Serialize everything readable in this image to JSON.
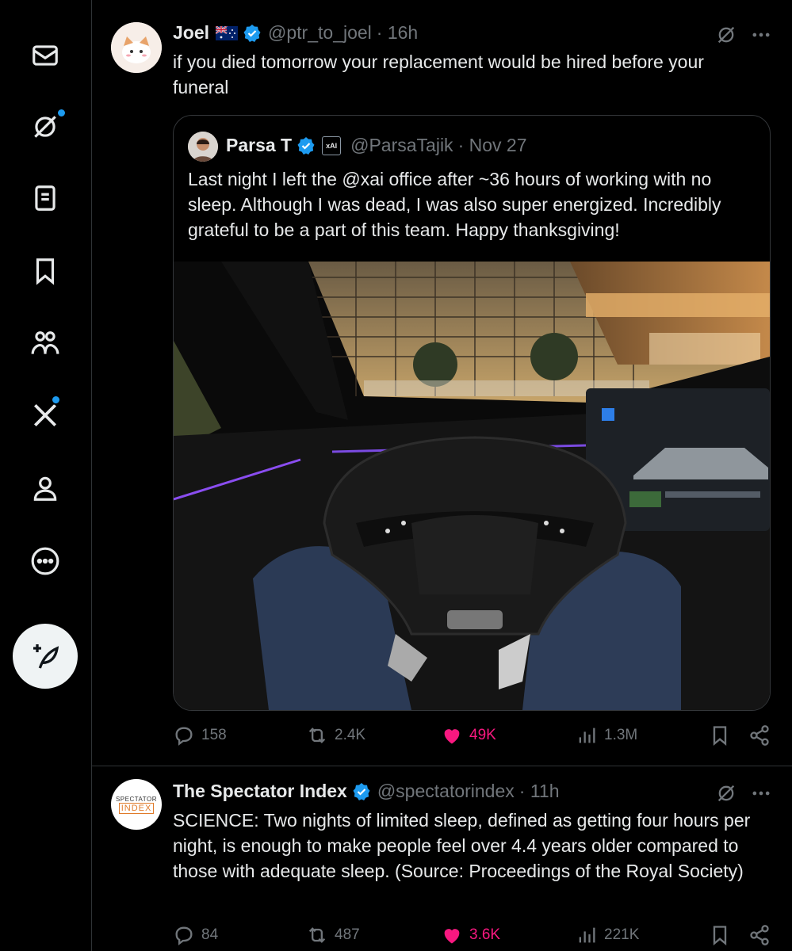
{
  "sidebar": {
    "items": [
      {
        "icon": "envelope-icon"
      },
      {
        "icon": "grok-icon",
        "badge": true
      },
      {
        "icon": "lists-icon"
      },
      {
        "icon": "bookmark-icon"
      },
      {
        "icon": "communities-icon"
      },
      {
        "icon": "x-premium-icon",
        "badge": true
      },
      {
        "icon": "profile-icon"
      },
      {
        "icon": "more-circle-icon"
      }
    ],
    "compose_icon": "compose-feather-icon"
  },
  "tweets": [
    {
      "name": "Joel",
      "flag": "australia-flag",
      "handle": "@ptr_to_joel",
      "time": "· 16h",
      "text": "if you died tomorrow your replacement would be hired before your funeral",
      "quote": {
        "name": "Parsa T",
        "handle": "@ParsaTajik",
        "time": "· Nov 27",
        "affiliate_badge": "xAI",
        "text": "Last night I left the @xai office after ~36 hours of working with no sleep. Although I was dead, I was also super energized. Incredibly grateful to be a part of this team. Happy thanksgiving!"
      },
      "replies": "158",
      "reposts": "2.4K",
      "likes": "49K",
      "views": "1.3M"
    },
    {
      "name": "The Spectator Index",
      "handle": "@spectatorindex",
      "time": "· 11h",
      "avatar_text_top": "SPECTATOR",
      "avatar_text_bottom": "INDEX",
      "text": "SCIENCE: Two nights of limited sleep, defined as getting four hours per night, is enough to make people feel over 4.4 years older compared to those with adequate sleep.  (Source: Proceedings of the Royal Society)",
      "replies": "84",
      "reposts": "487",
      "likes": "3.6K",
      "views": "221K"
    }
  ],
  "colors": {
    "accent": "#1d9bf0",
    "like": "#f91880",
    "muted": "#71767b",
    "border": "#2f3336"
  }
}
